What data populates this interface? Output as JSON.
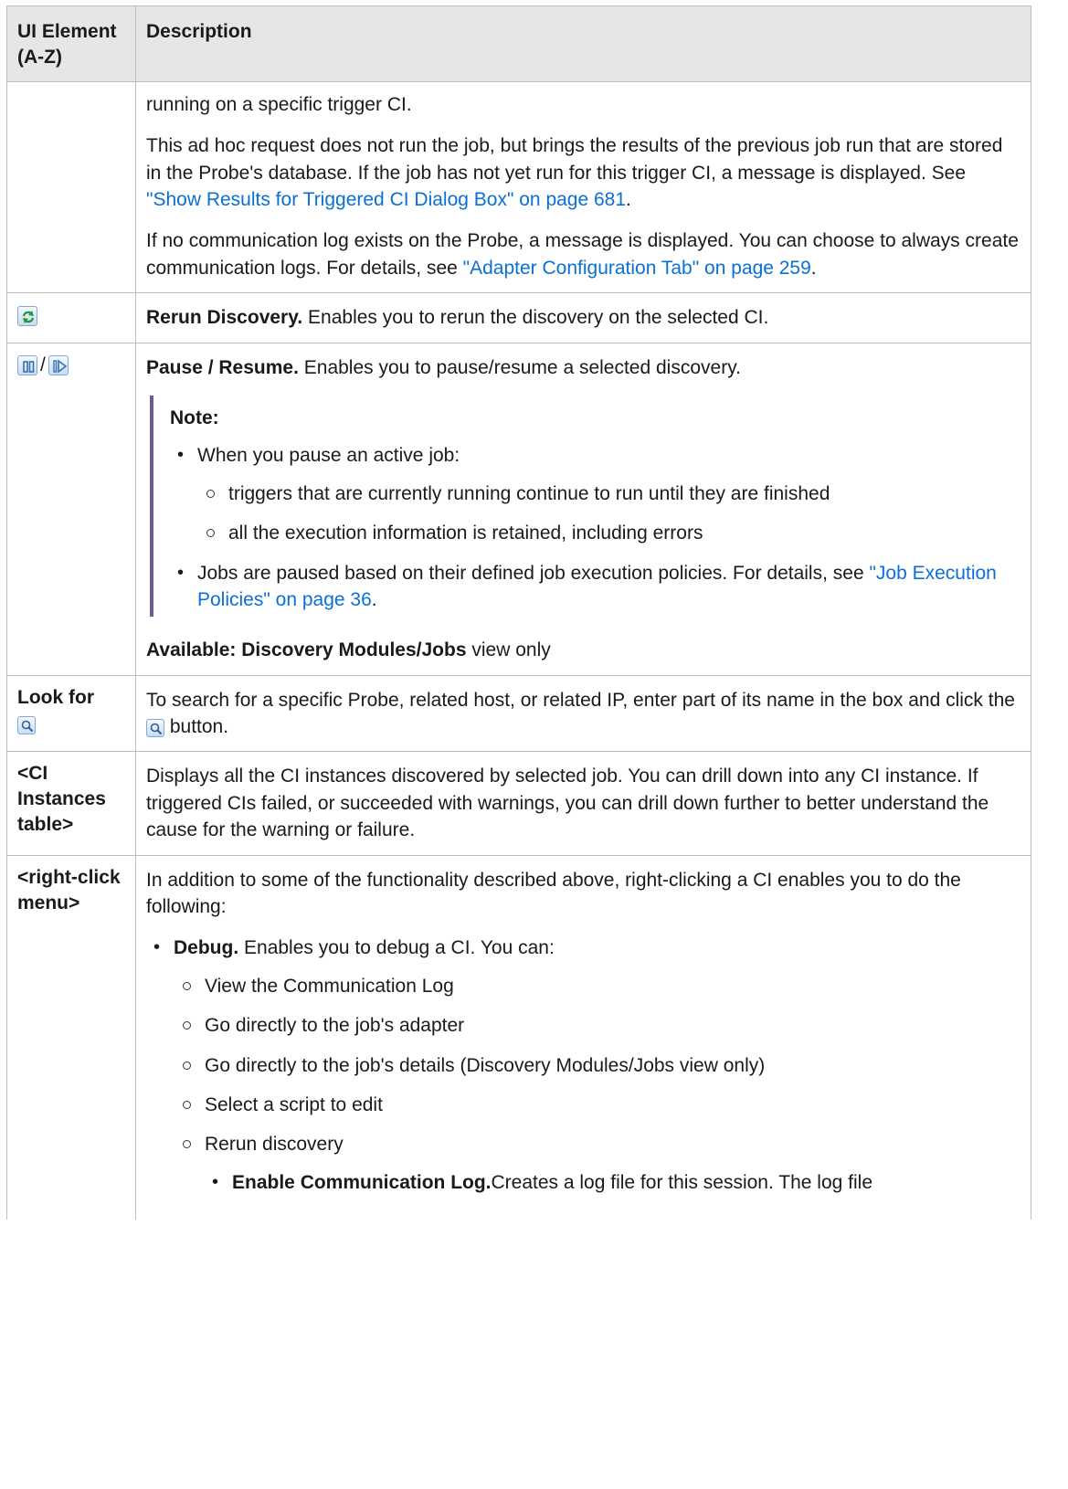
{
  "table": {
    "header_element": "UI Element (A-Z)",
    "header_description": "Description"
  },
  "row_continuation": {
    "p1": "running on a specific trigger CI.",
    "p2_text": "This ad hoc request does not run the job, but brings the results of the previous job run that are stored in the Probe's database. If the job has not yet run for this trigger CI, a message is displayed. See ",
    "p2_link": "\"Show Results for Triggered CI Dialog Box\" on page 681",
    "p3_text": "If no communication log exists on the Probe, a message is displayed. You can choose to always create communication logs. For details, see ",
    "p3_link": "\"Adapter Configuration Tab\" on page 259"
  },
  "row_rerun": {
    "icon": "rerun-discovery-icon",
    "title": "Rerun Discovery.",
    "text": "Enables you to rerun the discovery on the selected CI."
  },
  "row_pause": {
    "icon_pause": "pause-icon",
    "icon_resume": "resume-icon",
    "title": "Pause / Resume.",
    "text": "Enables you to pause/resume a selected discovery.",
    "note_label": "Note:",
    "note_item1": "When you pause an active job:",
    "note_sub1": "triggers that are currently running continue to run until they are finished",
    "note_sub2": "all the execution information is retained, including errors",
    "note_item2_text": "Jobs are paused based on their defined job execution policies. For details, see ",
    "note_item2_link": "\"Job Execution Policies\" on page 36",
    "available_label": "Available: Discovery Modules/Jobs",
    "available_rest": "view only"
  },
  "row_lookfor": {
    "element": "Look for",
    "icon": "search-icon",
    "text1": "To search for a specific Probe, related host, or related IP, enter part of its name in the box and click the ",
    "text2": "button."
  },
  "row_ci_table": {
    "element": "<CI Instances table>",
    "text": "Displays all the CI instances discovered by selected job. You can drill down into any CI instance. If triggered CIs failed, or succeeded with warnings, you can drill down further to better understand the cause for the warning or failure."
  },
  "row_rightclick": {
    "element": "<right-click menu>",
    "intro": "In addition to some of the functionality described above, right-clicking a CI enables you to do the following:",
    "debug_title": "Debug.",
    "debug_text": "Enables you to debug a CI. You can:",
    "sub_items": [
      "View the Communication Log",
      "Go directly to the job's adapter",
      "Go directly to the job's details (Discovery Modules/Jobs view only)",
      "Select a script to edit",
      "Rerun discovery"
    ],
    "enable_title": "Enable Communication Log.",
    "enable_text": "Creates a log file for this session. The log file"
  }
}
